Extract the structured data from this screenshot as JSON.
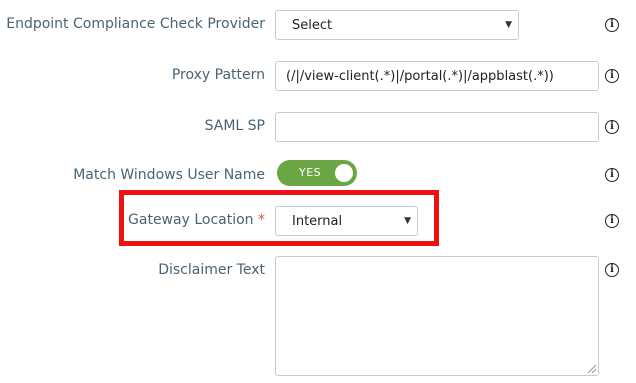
{
  "fields": {
    "endpoint": {
      "label": "Endpoint Compliance Check Provider",
      "value": "Select"
    },
    "proxy": {
      "label": "Proxy Pattern",
      "value": "(/|/view-client(.*)|/portal(.*)|/appblast(.*))"
    },
    "saml": {
      "label": "SAML SP",
      "value": ""
    },
    "match_windows": {
      "label": "Match Windows User Name",
      "toggle_text": "YES",
      "state": "on"
    },
    "gateway": {
      "label": "Gateway Location",
      "required_mark": "*",
      "value": "Internal"
    },
    "disclaimer": {
      "label": "Disclaimer Text",
      "value": ""
    }
  },
  "icons": {
    "info": "info-circle-icon",
    "caret": "caret-down-icon"
  },
  "info_glyph": "i",
  "caret_glyph": "▼",
  "colors": {
    "toggle_on": "#6aa643",
    "highlight": "#ee1111",
    "required": "#cf5a3a"
  }
}
